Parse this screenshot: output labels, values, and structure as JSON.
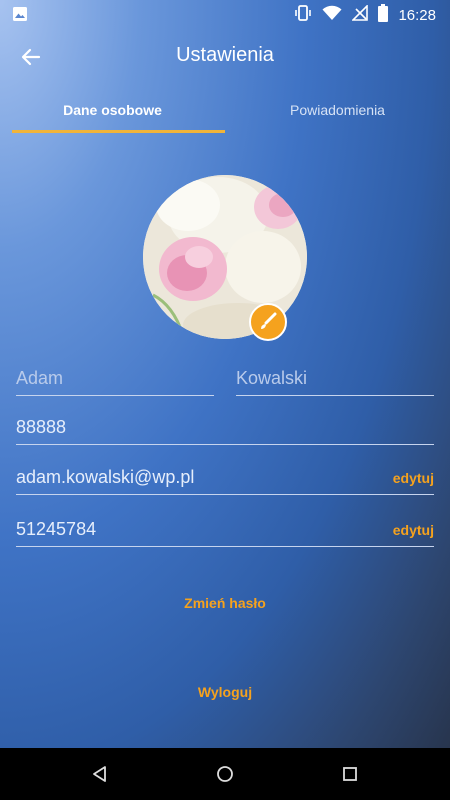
{
  "status_bar": {
    "time": "16:28",
    "icons": [
      "image-icon",
      "vibrate-icon",
      "wifi-icon",
      "no-signal-icon",
      "battery-icon"
    ]
  },
  "app_bar": {
    "title": "Ustawienia",
    "back_icon": "arrow-left-icon"
  },
  "tabs": [
    {
      "label": "Dane osobowe",
      "active": true
    },
    {
      "label": "Powiadomienia",
      "active": false
    }
  ],
  "profile": {
    "first_name": "Adam",
    "last_name": "Kowalski",
    "code": "88888",
    "email": "adam.kowalski@wp.pl",
    "phone": "51245784",
    "edit_label": "edytuj"
  },
  "actions": {
    "change_password": "Zmień hasło",
    "logout": "Wyloguj"
  },
  "colors": {
    "accent": "#f5a21e",
    "tab_indicator": "#f1b43a",
    "nav_bar": "#000000"
  }
}
